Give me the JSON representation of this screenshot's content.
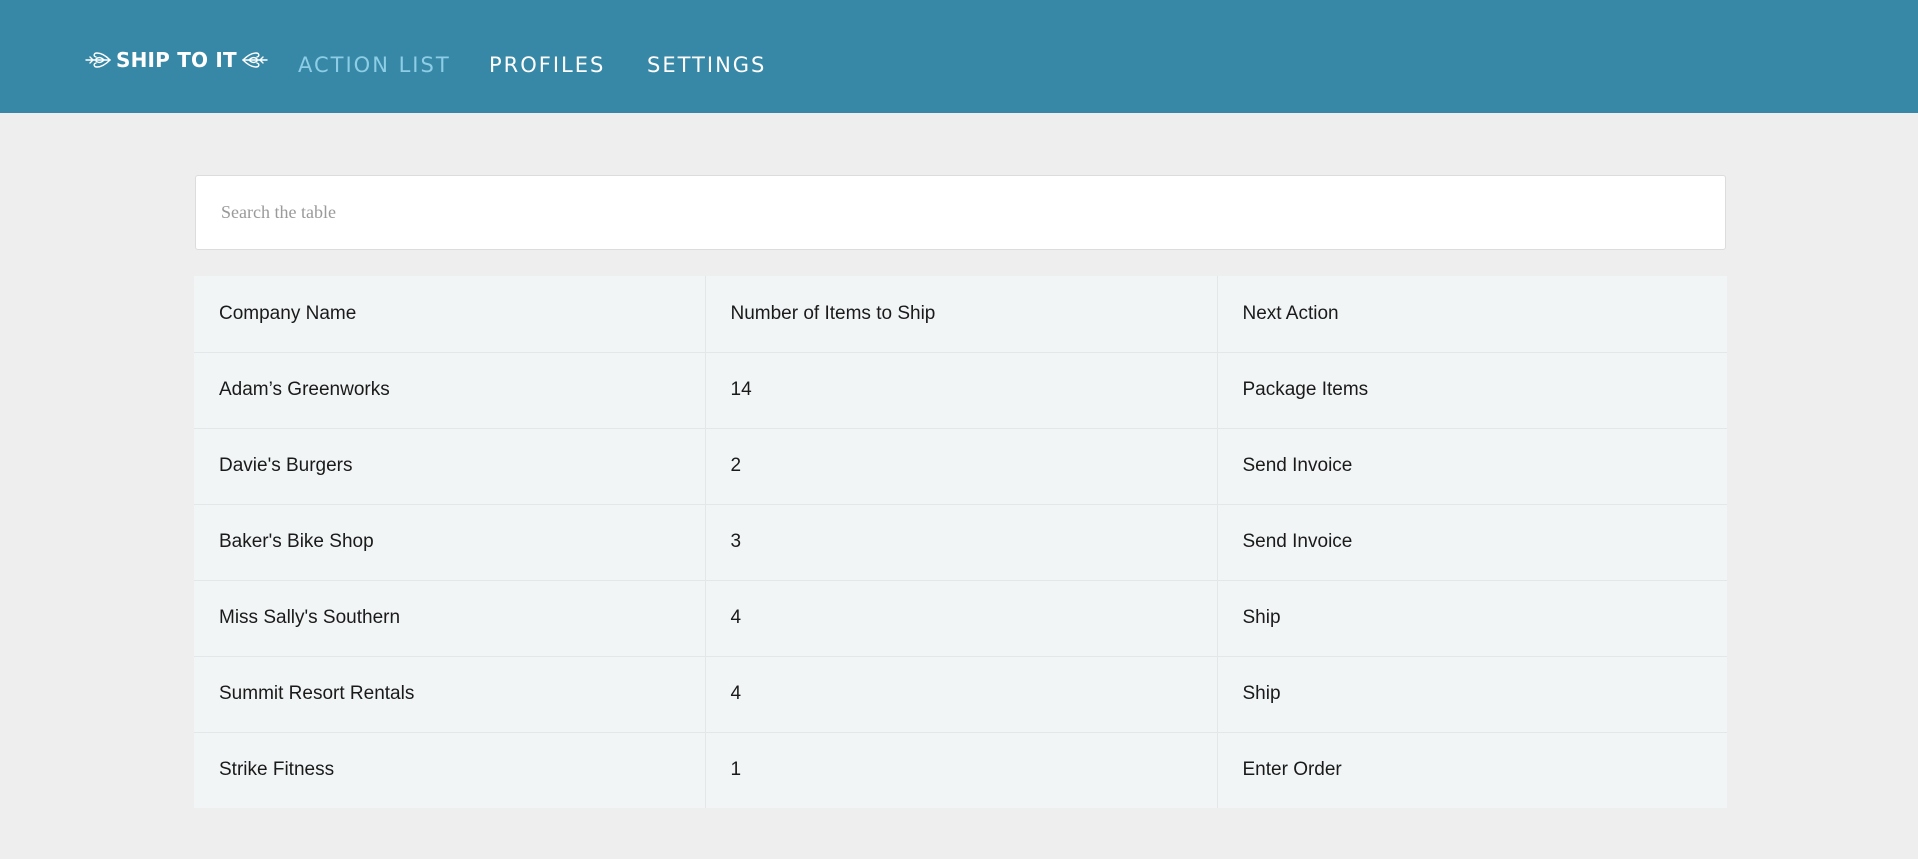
{
  "app": {
    "brand": "SHIP TO IT",
    "colors": {
      "header": "#3788a7",
      "nav_active": "#8dcde6",
      "page_bg": "#eeeeee",
      "table_bg": "#f2f5f6"
    }
  },
  "nav": {
    "items": [
      {
        "label": "ACTION LIST",
        "active": true
      },
      {
        "label": "PROFILES",
        "active": false
      },
      {
        "label": "SETTINGS",
        "active": false
      }
    ]
  },
  "search": {
    "placeholder": "Search the table",
    "value": ""
  },
  "table": {
    "headers": [
      "Company Name",
      "Number of Items to Ship",
      "Next Action"
    ],
    "rows": [
      [
        "Adam’s Greenworks",
        "14",
        "Package Items"
      ],
      [
        "Davie's Burgers",
        "2",
        "Send Invoice"
      ],
      [
        "Baker's Bike Shop",
        "3",
        "Send Invoice"
      ],
      [
        "Miss Sally's Southern",
        "4",
        "Ship"
      ],
      [
        "Summit Resort Rentals",
        "4",
        "Ship"
      ],
      [
        "Strike Fitness",
        "1",
        "Enter Order"
      ]
    ]
  }
}
